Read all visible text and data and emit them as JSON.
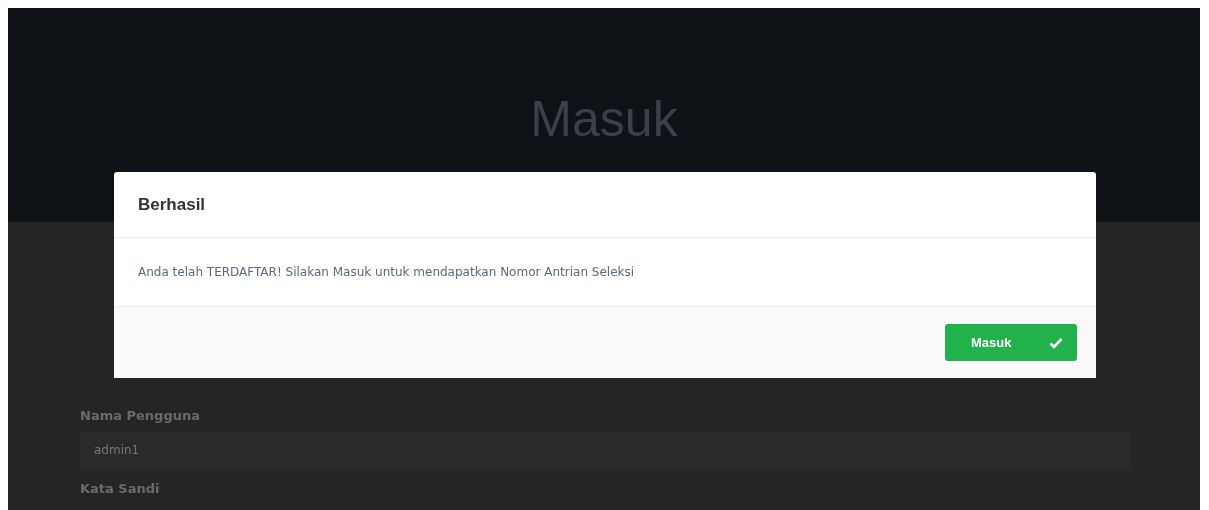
{
  "page": {
    "title": "Masuk"
  },
  "form": {
    "fields": [
      {
        "label": "Nama Pengguna",
        "value": "admin1"
      },
      {
        "label": "Kata Sandi"
      }
    ]
  },
  "modal": {
    "title": "Berhasil",
    "message": "Anda telah TERDAFTAR! Silakan Masuk untuk mendapatkan Nomor Antrian Seleksi",
    "button": "Masuk"
  }
}
